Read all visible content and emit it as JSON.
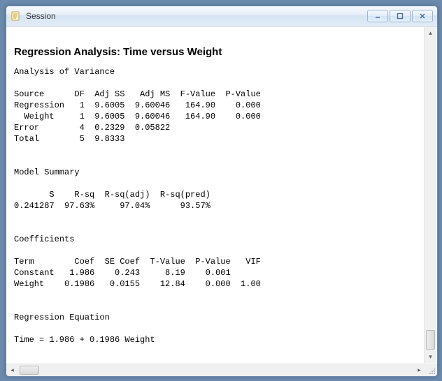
{
  "window": {
    "title": "Session"
  },
  "report": {
    "heading": "Regression Analysis: Time versus Weight",
    "anova_heading": "Analysis of Variance",
    "anova_cols": "Source      DF  Adj SS   Adj MS  F-Value  P-Value",
    "anova_rows": [
      "Regression   1  9.6005  9.60046   164.90    0.000",
      "  Weight     1  9.6005  9.60046   164.90    0.000",
      "Error        4  0.2329  0.05822",
      "Total        5  9.8333"
    ],
    "model_summary_heading": "Model Summary",
    "model_summary_cols": "       S    R-sq  R-sq(adj)  R-sq(pred)",
    "model_summary_row": "0.241287  97.63%     97.04%      93.57%",
    "coef_heading": "Coefficients",
    "coef_cols": "Term        Coef  SE Coef  T-Value  P-Value   VIF",
    "coef_rows": [
      "Constant   1.986    0.243     8.19    0.001",
      "Weight    0.1986   0.0155    12.84    0.000  1.00"
    ],
    "equation_heading": "Regression Equation",
    "equation": "Time = 1.986 + 0.1986 Weight"
  }
}
